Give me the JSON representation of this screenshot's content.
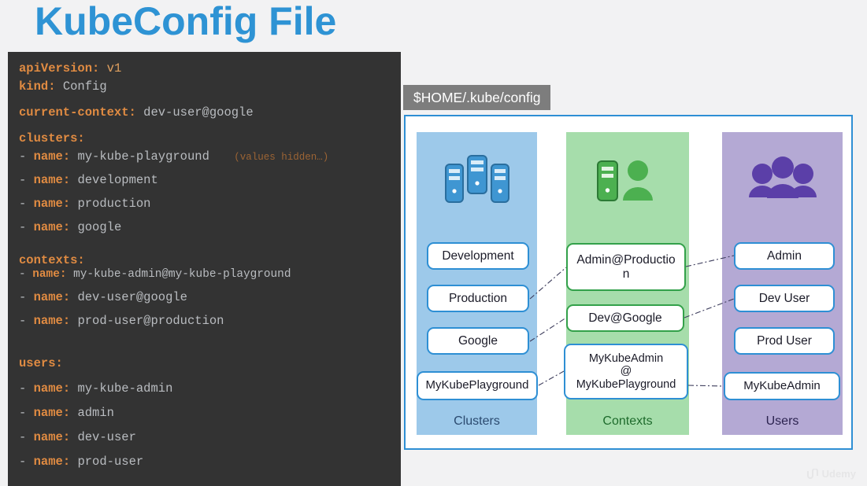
{
  "slide": {
    "title": "KubeConfig File",
    "background_color": "#f2f2f3",
    "title_color": "#2e93d4"
  },
  "code_panel": {
    "background_color": "#333333",
    "key_color": "#e08b42",
    "value_color": "#b9bcc0",
    "note_color": "#9c6434",
    "lines": [
      {
        "key": "apiVersion:",
        "value": "v1"
      },
      {
        "key": "kind:",
        "value": "Config"
      },
      {
        "key": "current-context:",
        "value": "dev-user@google"
      },
      {
        "key": "clusters:",
        "value": ""
      },
      {
        "dash": "-",
        "key": "name:",
        "value": "my-kube-playground",
        "note": "(values hidden…)"
      },
      {
        "dash": "-",
        "key": "name:",
        "value": "development"
      },
      {
        "dash": "-",
        "key": "name:",
        "value": "production"
      },
      {
        "dash": "-",
        "key": "name:",
        "value": "google"
      },
      {
        "key": "contexts:",
        "value": ""
      },
      {
        "dash": "-",
        "key": "name:",
        "value": "my-kube-admin@my-kube-playground"
      },
      {
        "dash": "-",
        "key": "name:",
        "value": "dev-user@google"
      },
      {
        "dash": "-",
        "key": "name:",
        "value": "prod-user@production"
      },
      {
        "key": "users:",
        "value": ""
      },
      {
        "dash": "-",
        "key": "name:",
        "value": "my-kube-admin"
      },
      {
        "dash": "-",
        "key": "name:",
        "value": "admin"
      },
      {
        "dash": "-",
        "key": "name:",
        "value": "dev-user"
      },
      {
        "dash": "-",
        "key": "name:",
        "value": "prod-user"
      }
    ],
    "text": {
      "l0_key": "apiVersion:",
      "l0_val": "v1",
      "l1_key": "kind:",
      "l1_val": "Config",
      "l2_key": "current-context:",
      "l2_val": "dev-user@google",
      "l3_key": "clusters:",
      "l4_key": "name:",
      "l4_val": "my-kube-playground",
      "l4_note": "(values hidden…)",
      "l5_key": "name:",
      "l5_val": "development",
      "l6_key": "name:",
      "l6_val": "production",
      "l7_key": "name:",
      "l7_val": "google",
      "l8_key": "contexts:",
      "l9_key": "name:",
      "l9_val": "my-kube-admin@my-kube-playground",
      "l10_key": "name:",
      "l10_val": "dev-user@google",
      "l11_key": "name:",
      "l11_val": "prod-user@production",
      "l12_key": "users:",
      "l13_key": "name:",
      "l13_val": "my-kube-admin",
      "l14_key": "name:",
      "l14_val": "admin",
      "l15_key": "name:",
      "l15_val": "dev-user",
      "l16_key": "name:",
      "l16_val": "prod-user",
      "dash": "-"
    }
  },
  "diagram": {
    "file_path_badge": "$HOME/.kube/config",
    "badge_color": "#7d7d7d",
    "frame_border_color": "#2e8fd4",
    "columns": {
      "clusters": {
        "label": "Clusters",
        "fill_color": "#9dc9ea",
        "icon": "servers-icon",
        "nodes": [
          "Development",
          "Production",
          "Google",
          "MyKubePlayground"
        ]
      },
      "contexts": {
        "label": "Contexts",
        "fill_color": "#a6ddab",
        "icon": "server-user-icon",
        "nodes": [
          "Admin@Production",
          "Dev@Google",
          "MyKubeAdmin@MyKubePlayground"
        ]
      },
      "users": {
        "label": "Users",
        "fill_color": "#b4a9d4",
        "icon": "users-group-icon",
        "nodes": [
          "Admin",
          "Dev User",
          "Prod User",
          "MyKubeAdmin"
        ]
      }
    },
    "nodes": {
      "development": "Development",
      "production": "Production",
      "google": "Google",
      "mykubeplayground": "MyKubePlayground",
      "admin_production_line1": "Admin@Productio",
      "admin_production_line2": "n",
      "dev_google": "Dev@Google",
      "mykubeadmin_ctx_line1": "MyKubeAdmin",
      "mykubeadmin_ctx_line2": "@",
      "mykubeadmin_ctx_line3": "MyKubePlayground",
      "admin": "Admin",
      "dev_user": "Dev User",
      "prod_user": "Prod User",
      "mykubeadmin_user": "MyKubeAdmin"
    }
  },
  "watermark": {
    "text": "Udemy"
  }
}
